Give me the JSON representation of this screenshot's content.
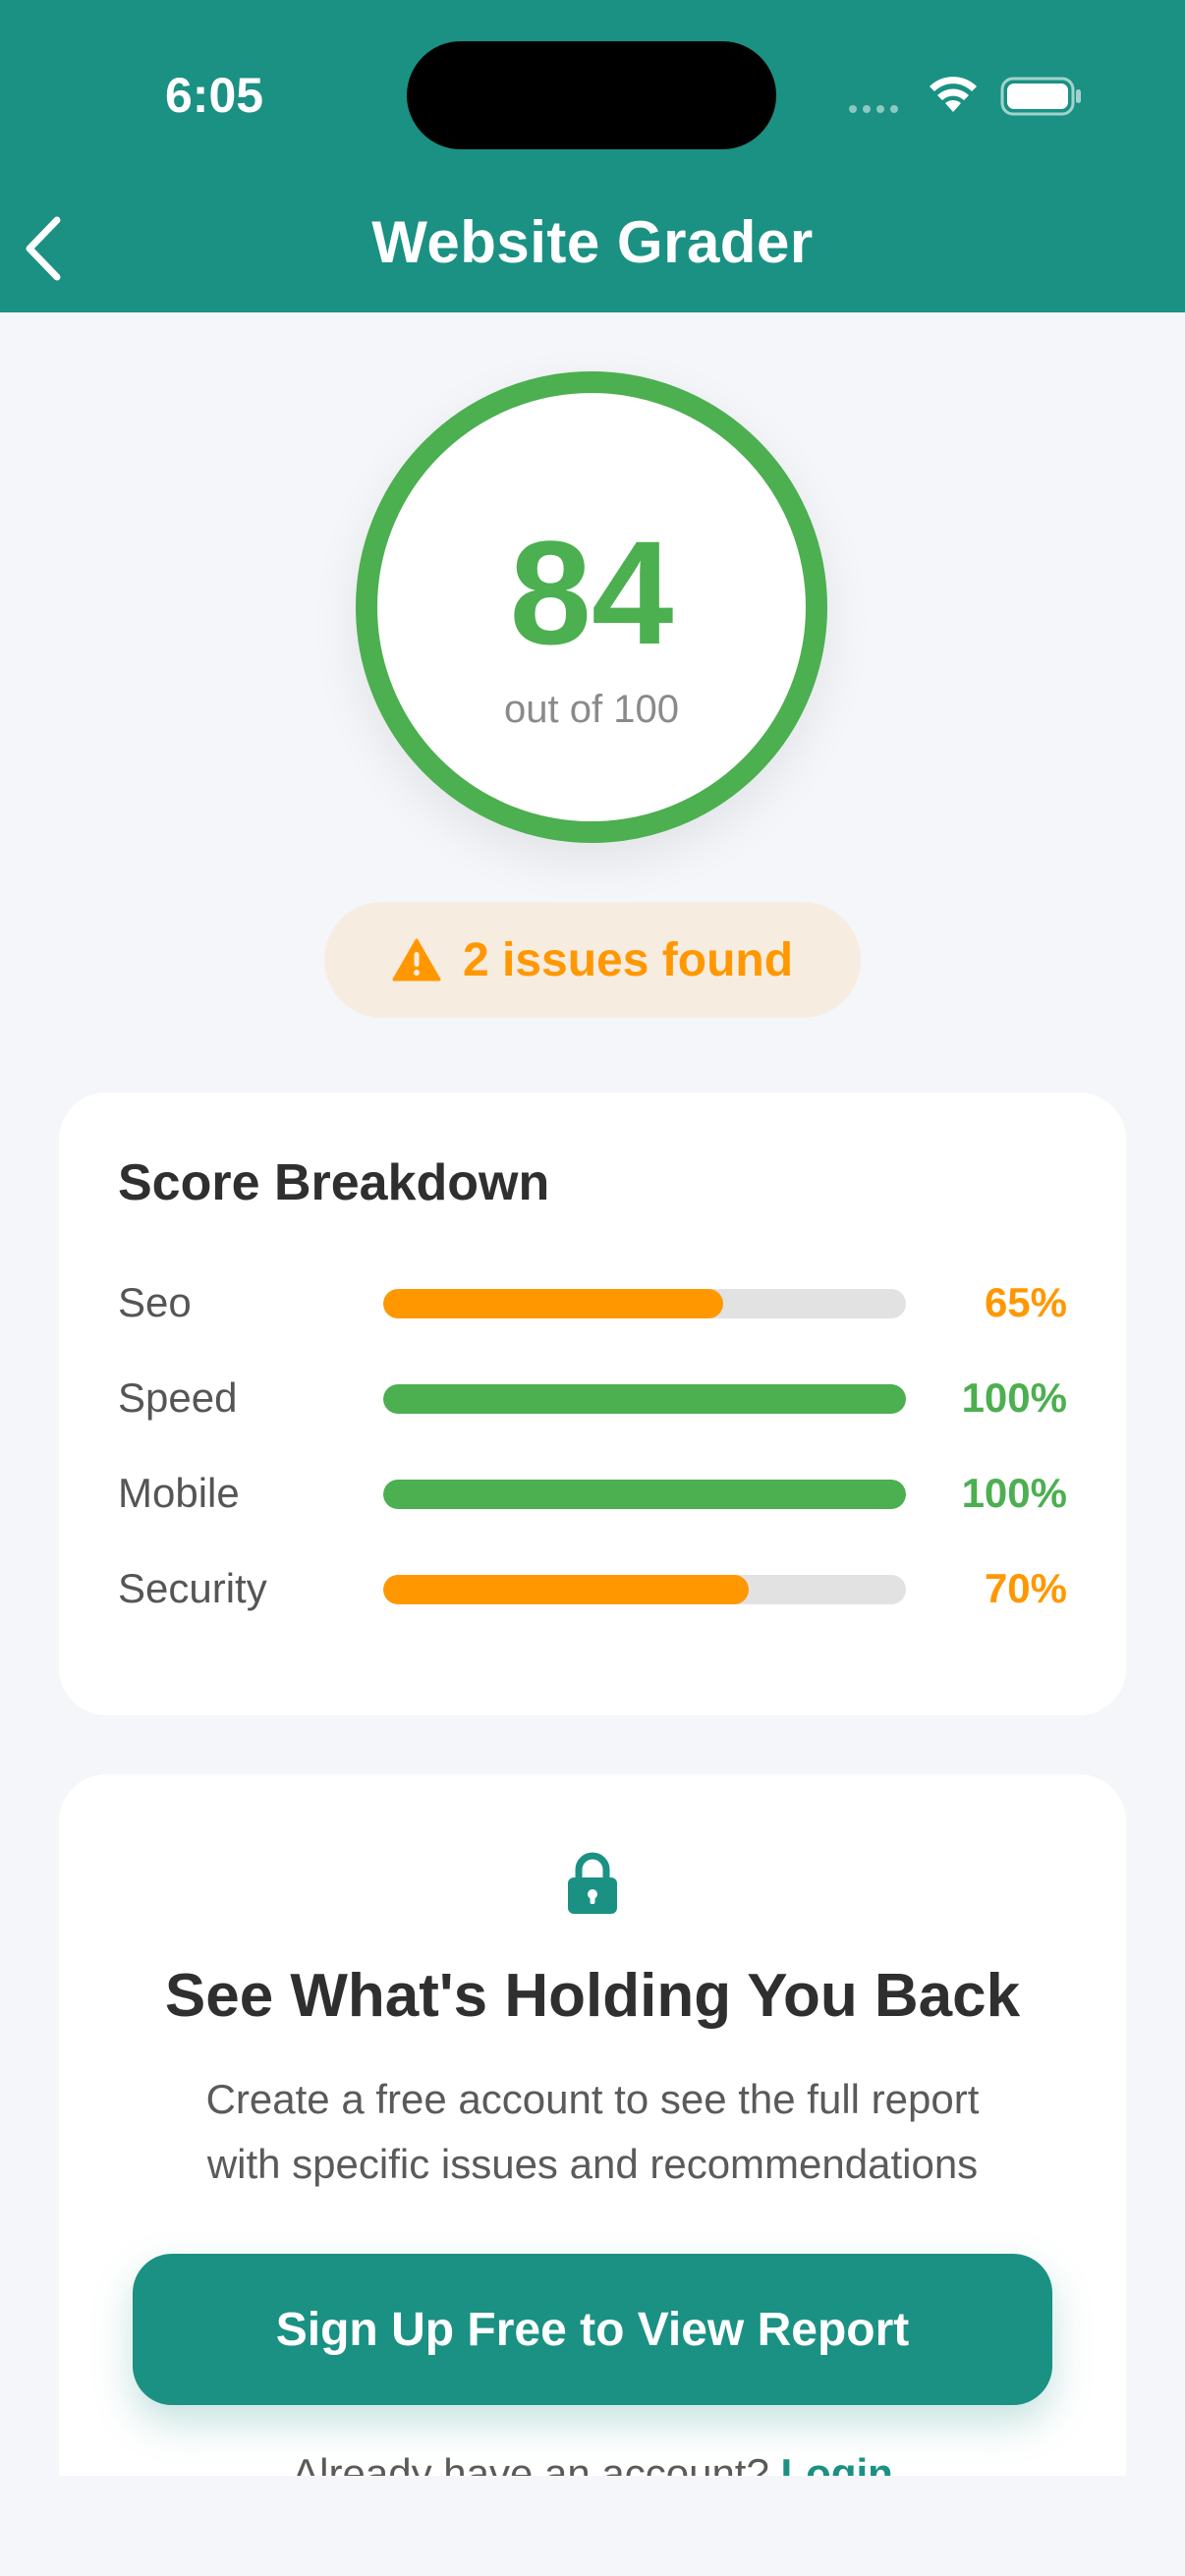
{
  "status_bar": {
    "time": "6:05"
  },
  "header": {
    "title": "Website Grader"
  },
  "score": {
    "value": "84",
    "subtitle": "out of 100",
    "color": "#4caf50"
  },
  "issues": {
    "label": "2 issues found",
    "color": "#ff9800"
  },
  "breakdown": {
    "title": "Score Breakdown",
    "metrics": [
      {
        "label": "Seo",
        "value": "65%",
        "fraction": 0.65,
        "color": "#ff9800"
      },
      {
        "label": "Speed",
        "value": "100%",
        "fraction": 1.0,
        "color": "#4caf50"
      },
      {
        "label": "Mobile",
        "value": "100%",
        "fraction": 1.0,
        "color": "#4caf50"
      },
      {
        "label": "Security",
        "value": "70%",
        "fraction": 0.7,
        "color": "#ff9800"
      }
    ]
  },
  "cta": {
    "title": "See What's Holding You Back",
    "description_line1": "Create a free account to see the full report",
    "description_line2": "with specific issues and recommendations",
    "button_label": "Sign Up Free to View Report",
    "login_prompt": "Already have an account?",
    "login_link": "Login"
  },
  "colors": {
    "brand": "#1a9183",
    "good": "#4caf50",
    "warn": "#ff9800"
  }
}
